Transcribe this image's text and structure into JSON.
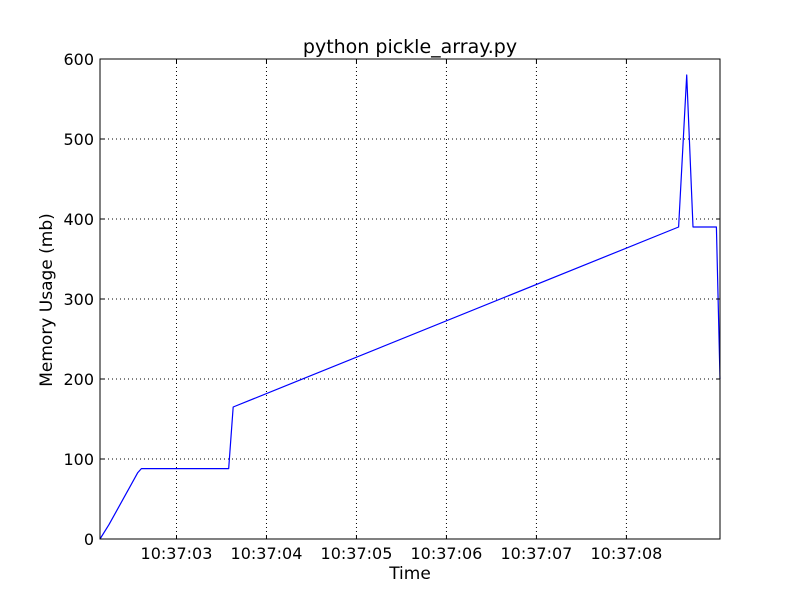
{
  "chart_data": {
    "type": "line",
    "title": "python pickle_array.py",
    "xlabel": "Time",
    "ylabel": "Memory Usage (mb)",
    "xlim": [
      "10:37:02.15",
      "10:37:09.04"
    ],
    "ylim": [
      0,
      600
    ],
    "x_ticks": [
      "10:37:03",
      "10:37:04",
      "10:37:05",
      "10:37:06",
      "10:37:07",
      "10:37:08"
    ],
    "y_ticks": [
      0,
      100,
      200,
      300,
      400,
      500,
      600
    ],
    "grid": true,
    "series": [
      {
        "color": "#0000ff",
        "points": [
          {
            "x": "10:37:02.15",
            "y": 0
          },
          {
            "x": "10:37:02.25",
            "y": 18
          },
          {
            "x": "10:37:02.57",
            "y": 83
          },
          {
            "x": "10:37:02.61",
            "y": 88
          },
          {
            "x": "10:37:03.58",
            "y": 88
          },
          {
            "x": "10:37:03.63",
            "y": 165
          },
          {
            "x": "10:37:08.58",
            "y": 390
          },
          {
            "x": "10:37:08.67",
            "y": 580
          },
          {
            "x": "10:37:08.74",
            "y": 390
          },
          {
            "x": "10:37:09.00",
            "y": 390
          },
          {
            "x": "10:37:09.04",
            "y": 200
          }
        ]
      }
    ]
  }
}
